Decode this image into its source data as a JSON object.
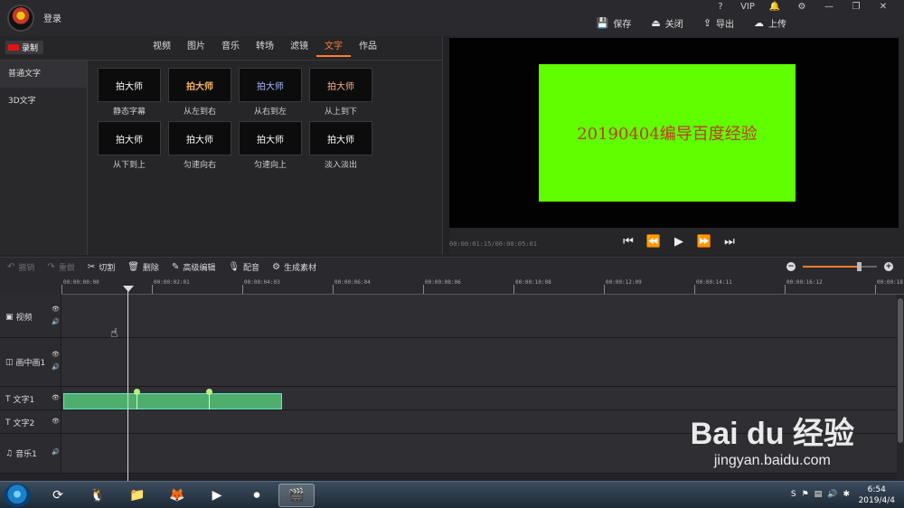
{
  "titlebar": {
    "login_label": "登录",
    "window_icons": [
      "?",
      "VIP",
      "🔔",
      "⚙",
      "—",
      "❐",
      "✕"
    ],
    "actions": [
      {
        "icon": "save-icon",
        "glyph": "💾",
        "label": "保存"
      },
      {
        "icon": "exit-icon",
        "glyph": "⏏",
        "label": "关闭"
      },
      {
        "icon": "export-icon",
        "glyph": "⇪",
        "label": "导出"
      },
      {
        "icon": "upload-icon",
        "glyph": "☁",
        "label": "上传"
      }
    ]
  },
  "library": {
    "record_label": "录制",
    "tabs": [
      "视频",
      "图片",
      "音乐",
      "转场",
      "滤镜",
      "文字",
      "作品"
    ],
    "active_tab": "文字",
    "categories": [
      "普通文字",
      "3D文字"
    ],
    "presets": [
      {
        "thumb": "拍大师",
        "label": "静态字幕"
      },
      {
        "thumb": "拍大师",
        "label": "从左到右"
      },
      {
        "thumb": "拍大师",
        "label": "从右到左"
      },
      {
        "thumb": "拍大师",
        "label": "从上到下"
      },
      {
        "thumb": "拍大师",
        "label": "从下到上"
      },
      {
        "thumb": "拍大师",
        "label": "匀速向右"
      },
      {
        "thumb": "拍大师",
        "label": "匀速向上"
      },
      {
        "thumb": "拍大师",
        "label": "淡入淡出"
      }
    ]
  },
  "preview": {
    "frame_text": "20190404编导百度经验",
    "frame_color": "#60ff00",
    "text_color": "#c0392b",
    "timecode": "00:00:01:15/00:00:05:01",
    "controls": [
      "⏮",
      "⏪",
      "▶",
      "⏩",
      "⏭"
    ]
  },
  "toolbar": {
    "undo": "撤销",
    "redo": "重做",
    "cut": "切割",
    "delete": "删除",
    "advanced": "高级编辑",
    "dub": "配音",
    "generate": "生成素材",
    "zoom_level": 0.75
  },
  "ruler": {
    "marks": [
      "00:00:00:00",
      "00:00:02:01",
      "00:00:04:03",
      "00:00:06:04",
      "00:00:08:06",
      "00:00:10:08",
      "00:00:12:09",
      "00:00:14:11",
      "00:00:16:12",
      "00:00:18:"
    ]
  },
  "tracks": [
    {
      "name": "视频",
      "icon": "▣",
      "eye": true,
      "sound": true
    },
    {
      "name": "画中画1",
      "icon": "◫",
      "eye": true,
      "sound": true
    },
    {
      "name": "文字1",
      "icon": "T",
      "eye": true,
      "sound": false
    },
    {
      "name": "文字2",
      "icon": "T",
      "eye": true,
      "sound": false
    },
    {
      "name": "音乐1",
      "icon": "♫",
      "eye": false,
      "sound": true
    }
  ],
  "taskbar": {
    "time": "6:54",
    "date": "2019/4/4"
  },
  "watermark": {
    "brand": "Bai du 经验",
    "url": "jingyan.baidu.com"
  }
}
